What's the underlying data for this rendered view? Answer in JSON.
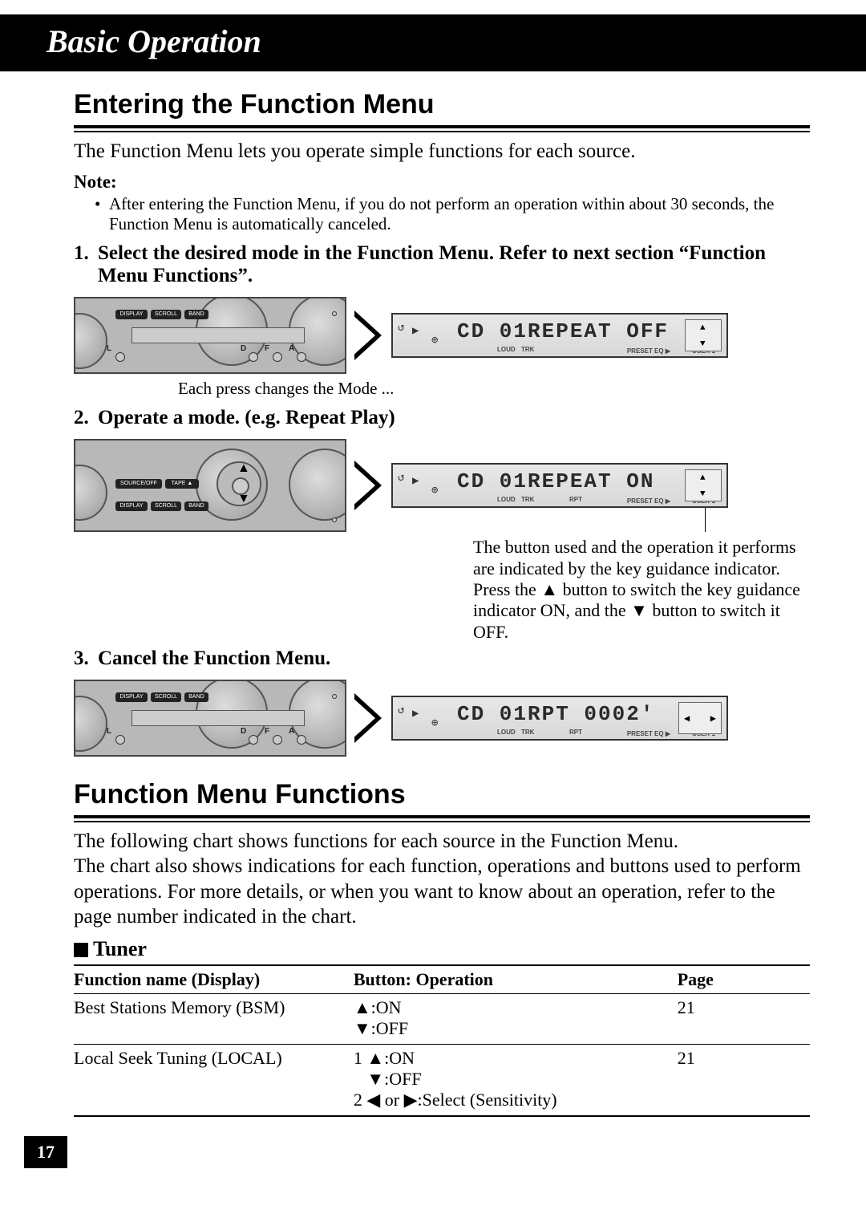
{
  "header": {
    "title": "Basic Operation"
  },
  "section1": {
    "title": "Entering the Function Menu",
    "intro": "The Function Menu lets you operate simple functions for each source.",
    "note_label": "Note:",
    "note_bullet": "After entering the Function Menu, if you do not perform an operation within about 30 seconds, the Function Menu is automatically canceled.",
    "step1_num": "1.",
    "step1_text": "Select the desired mode in the Function Menu. Refer to next section “Function Menu Functions”.",
    "panel1_btns": [
      "DISPLAY",
      "SCROLL",
      "BAND"
    ],
    "panel1_labels": [
      "L",
      "D",
      "F",
      "A"
    ],
    "lcd1_text": "CD 01REPEAT OFF",
    "lcd_small_loud": "LOUD",
    "lcd_small_trk": "TRK",
    "lcd_small_preset": "PRESET EQ ▶",
    "lcd_small_user": "USER 1",
    "caption1": "Each press changes the Mode ...",
    "step2_num": "2.",
    "step2_text": "Operate a mode. (e.g. Repeat Play)",
    "panel2_btns_row1": [
      "SOURCE/OFF",
      "TAPE ▲"
    ],
    "panel2_btns_row2": [
      "DISPLAY",
      "SCROLL",
      "BAND"
    ],
    "lcd2_text": "CD 01REPEAT ON",
    "lcd_small_rpt": "RPT",
    "side_para": "The button used and the operation it performs are indicated by the key guidance indicator. Press the ▲ button to switch the key guidance indicator ON, and the ▼ button to switch it OFF.",
    "step3_num": "3.",
    "step3_text": "Cancel the Function Menu.",
    "lcd3_text": "CD 01RPT   0002'"
  },
  "section2": {
    "title": "Function Menu Functions",
    "para": "The following chart shows functions for each source in the Function Menu.\nThe chart also shows indications for each function, operations and buttons used to perform operations. For more details, or when you want to know about an operation, refer to the page number indicated in the chart.",
    "tuner_label": "Tuner",
    "col1": "Function name (Display)",
    "col2": "Button: Operation",
    "col3": "Page",
    "rows": [
      {
        "name": "Best Stations Memory (BSM)",
        "ops": [
          "▲:ON",
          "▼:OFF"
        ],
        "page": "21"
      },
      {
        "name": "Local Seek Tuning (LOCAL)",
        "ops": [
          "1 ▲:ON",
          "   ▼:OFF",
          "2 ◀ or ▶:Select (Sensitivity)"
        ],
        "page": "21"
      }
    ]
  },
  "page_number": "17"
}
